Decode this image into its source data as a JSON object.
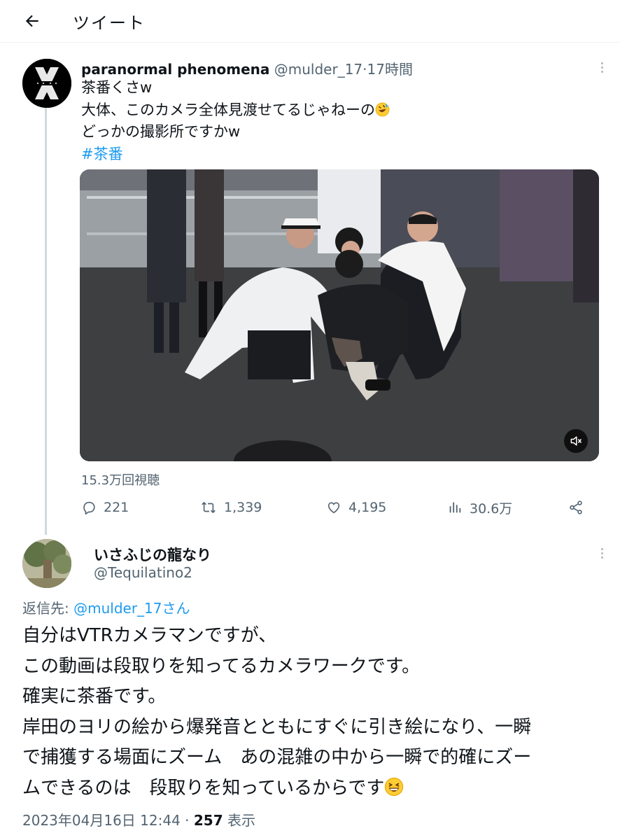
{
  "header": {
    "title": "ツイート"
  },
  "tweet": {
    "author_name": "paranormal phenomena",
    "handle": "@mulder_17",
    "separator": "·",
    "time": "17時間",
    "lines": [
      "茶番くさw",
      "大体、このカメラ全体見渡せてるじゃねーの",
      "どっかの撮影所ですかw"
    ],
    "hashtag": "#茶番",
    "views": "15.3万回視聴",
    "stats": {
      "replies": "221",
      "retweets": "1,339",
      "likes": "4,195",
      "impressions": "30.6万"
    }
  },
  "reply": {
    "author_name": "いさふじの龍なり",
    "handle": "@Tequilatino2",
    "reply_to_label": "返信先: ",
    "reply_to_handle": "@mulder_17さん",
    "lines": [
      "自分はVTRカメラマンですが、",
      "この動画は段取りを知ってるカメラワークです。",
      "確実に茶番です。",
      "岸田のヨリの絵から爆発音とともにすぐに引き絵になり、一瞬",
      "で捕獲する場面にズーム　あの混雑の中から一瞬で的確にズー",
      "ムできるのは　段取りを知っているからです"
    ],
    "timestamp": "2023年04月16日 12:44",
    "separator": " · ",
    "view_count": "257",
    "view_label": " 表示"
  },
  "icons": {
    "back": "arrow-left-icon",
    "more": "more-icon",
    "reply": "reply-icon",
    "retweet": "retweet-icon",
    "like": "heart-icon",
    "analytics": "analytics-icon",
    "share": "share-icon",
    "mute": "mute-icon"
  },
  "colors": {
    "link": "#1d9bf0",
    "secondary_text": "#536471",
    "thread_line": "#cfd9de"
  }
}
